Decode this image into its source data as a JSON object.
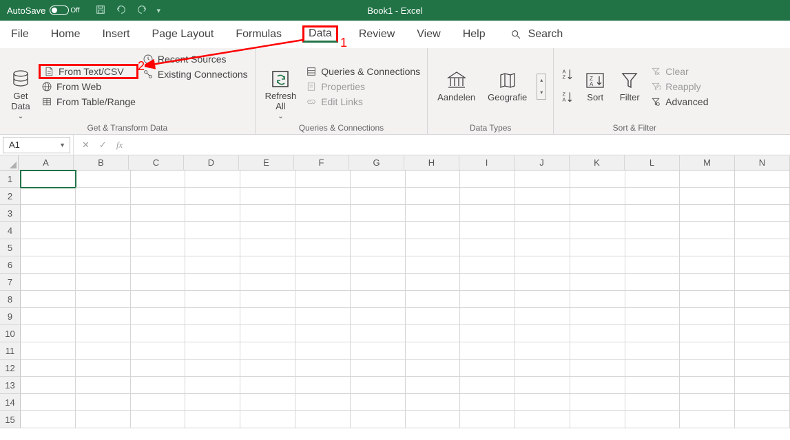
{
  "titlebar": {
    "autosave_label": "AutoSave",
    "autosave_state": "Off",
    "title": "Book1  -  Excel"
  },
  "tabs": {
    "items": [
      "File",
      "Home",
      "Insert",
      "Page Layout",
      "Formulas",
      "Data",
      "Review",
      "View",
      "Help"
    ],
    "active": "Data",
    "search_label": "Search"
  },
  "ribbon": {
    "get_transform": {
      "get_data": "Get\nData",
      "from_text_csv": "From Text/CSV",
      "from_web": "From Web",
      "from_table_range": "From Table/Range",
      "recent_sources": "Recent Sources",
      "existing_connections": "Existing Connections",
      "group_label": "Get & Transform Data"
    },
    "queries": {
      "refresh_all": "Refresh\nAll",
      "queries_connections": "Queries & Connections",
      "properties": "Properties",
      "edit_links": "Edit Links",
      "group_label": "Queries & Connections"
    },
    "data_types": {
      "item1": "Aandelen",
      "item2": "Geografie",
      "group_label": "Data Types"
    },
    "sort_filter": {
      "sort": "Sort",
      "filter": "Filter",
      "clear": "Clear",
      "reapply": "Reapply",
      "advanced": "Advanced",
      "group_label": "Sort & Filter"
    }
  },
  "formula_bar": {
    "name_box": "A1",
    "fx": "fx",
    "value": ""
  },
  "grid": {
    "columns": [
      "A",
      "B",
      "C",
      "D",
      "E",
      "F",
      "G",
      "H",
      "I",
      "J",
      "K",
      "L",
      "M",
      "N"
    ],
    "rows": [
      1,
      2,
      3,
      4,
      5,
      6,
      7,
      8,
      9,
      10,
      11,
      12,
      13,
      14,
      15
    ],
    "active_cell": "A1"
  },
  "annotations": {
    "n1": "1",
    "n2": "2"
  }
}
